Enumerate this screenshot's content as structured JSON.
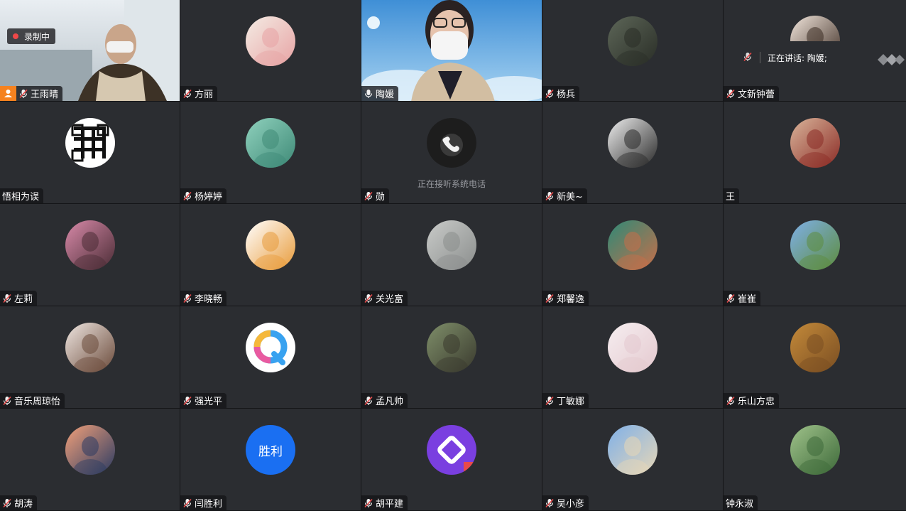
{
  "recording": {
    "label": "录制中"
  },
  "speaking_indicator": {
    "label": "正在讲话: 陶媛;"
  },
  "participants": [
    {
      "name": "王雨晴",
      "kind": "video-room",
      "muted": true,
      "host": true
    },
    {
      "name": "方丽",
      "kind": "avatar",
      "avatar_colors": [
        "#f4ece4",
        "#e7a3a4"
      ],
      "muted": true
    },
    {
      "name": "陶媛",
      "kind": "video-speaker",
      "muted": false,
      "speaking": true
    },
    {
      "name": "杨兵",
      "kind": "avatar",
      "avatar_colors": [
        "#5d6658",
        "#2a2e27"
      ],
      "muted": true
    },
    {
      "name": "文新钟蕾",
      "kind": "avatar-partial",
      "avatar_colors": [
        "#f2e6dc",
        "#3b2b22"
      ],
      "muted": true
    },
    {
      "name": "悟相为误",
      "kind": "avatar-qr",
      "avatar_colors": [
        "#ffffff",
        "#111111"
      ],
      "muted": null
    },
    {
      "name": "杨婷婷",
      "kind": "avatar",
      "avatar_colors": [
        "#8fd1bd",
        "#3f8a77"
      ],
      "muted": true
    },
    {
      "name": "勋",
      "kind": "phone",
      "status": "正在接听系统电话",
      "muted": true
    },
    {
      "name": "新美~",
      "kind": "avatar",
      "avatar_colors": [
        "#eeeeee",
        "#2a2a2a"
      ],
      "muted": true
    },
    {
      "name": "王",
      "kind": "avatar",
      "avatar_colors": [
        "#d9b49a",
        "#8b2c26"
      ],
      "muted": null
    },
    {
      "name": "左莉",
      "kind": "avatar",
      "avatar_colors": [
        "#d88aa9",
        "#4a2c35"
      ],
      "muted": true
    },
    {
      "name": "李晓畅",
      "kind": "avatar",
      "avatar_colors": [
        "#ffffff",
        "#e89b3a"
      ],
      "muted": true
    },
    {
      "name": "关光富",
      "kind": "avatar",
      "avatar_colors": [
        "#c9cbc9",
        "#8b8e8d"
      ],
      "muted": true
    },
    {
      "name": "郑馨逸",
      "kind": "avatar",
      "avatar_colors": [
        "#2e8a77",
        "#c76e49"
      ],
      "muted": true
    },
    {
      "name": "崔崔",
      "kind": "avatar",
      "avatar_colors": [
        "#7fb0e8",
        "#5d8c3e"
      ],
      "muted": true
    },
    {
      "name": "音乐周琼怡",
      "kind": "avatar",
      "avatar_colors": [
        "#efe6e1",
        "#6a4a3a"
      ],
      "muted": true
    },
    {
      "name": "强光平",
      "kind": "avatar-q",
      "avatar_colors": [
        "#ffffff",
        "#38a2f0"
      ],
      "muted": true
    },
    {
      "name": "孟凡帅",
      "kind": "avatar",
      "avatar_colors": [
        "#7f8f6a",
        "#3a3a2e"
      ],
      "muted": true
    },
    {
      "name": "丁敏娜",
      "kind": "avatar",
      "avatar_colors": [
        "#f6eef0",
        "#e4c9cf"
      ],
      "muted": true
    },
    {
      "name": "乐山方忠",
      "kind": "avatar",
      "avatar_colors": [
        "#c48a3a",
        "#7a4e22"
      ],
      "muted": true
    },
    {
      "name": "胡涛",
      "kind": "avatar",
      "avatar_colors": [
        "#f2a07a",
        "#2b3b62"
      ],
      "muted": true
    },
    {
      "name": "闫胜利",
      "kind": "avatar-text",
      "avatar_text": "胜利",
      "avatar_colors": [
        "#1a6ff2",
        "#1a6ff2"
      ],
      "muted": true
    },
    {
      "name": "胡平建",
      "kind": "avatar-app",
      "avatar_colors": [
        "#7a3fe0",
        "#ffffff"
      ],
      "muted": true
    },
    {
      "name": "吴小彦",
      "kind": "avatar",
      "avatar_colors": [
        "#7fb0e8",
        "#e7d7b7"
      ],
      "muted": true
    },
    {
      "name": "钟永淑",
      "kind": "avatar",
      "avatar_colors": [
        "#9fc28a",
        "#3e6a3a"
      ],
      "muted": null
    }
  ],
  "colors": {
    "tile_bg": "#2b2d31",
    "speaking_border": "#29c46a",
    "mute_red": "#e84a4a",
    "host_orange": "#f5821f"
  }
}
